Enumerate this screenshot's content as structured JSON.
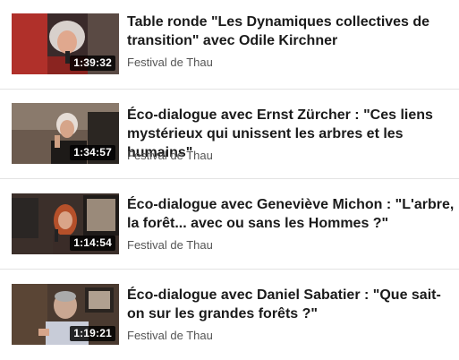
{
  "videos": [
    {
      "title": "Table ronde \"Les Dynamiques collectives de transition\" avec Odile Kirchner",
      "duration": "1:39:32",
      "channel": "Festival de Thau"
    },
    {
      "title": "Éco-dialogue avec Ernst Zürcher : \"Ces liens mystérieux qui unissent les arbres et les humains\"",
      "duration": "1:34:57",
      "channel": "Festival de Thau"
    },
    {
      "title": "Éco-dialogue avec Geneviève Michon : \"L'arbre, la forêt... avec ou sans les Hommes ?\"",
      "duration": "1:14:54",
      "channel": "Festival de Thau"
    },
    {
      "title": "Éco-dialogue avec Daniel Sabatier : \"Que sait-on sur les grandes forêts ?\"",
      "duration": "1:19:21",
      "channel": "Festival de Thau"
    }
  ]
}
